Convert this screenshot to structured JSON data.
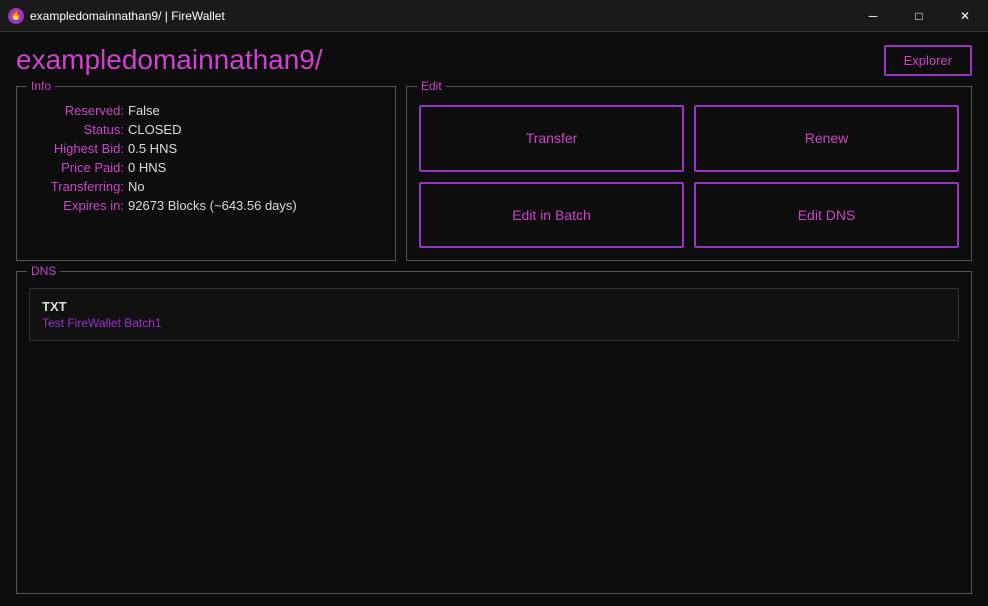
{
  "titlebar": {
    "app_name": "exampledomainnathan9/ | FireWallet",
    "icon": "🔥",
    "minimize": "─",
    "maximize": "□",
    "close": "✕"
  },
  "header": {
    "domain_title": "exampledomainnathan9/",
    "explorer_label": "Explorer"
  },
  "info_panel": {
    "legend": "Info",
    "fields": [
      {
        "label": "Reserved:",
        "value": "False"
      },
      {
        "label": "Status:",
        "value": "CLOSED"
      },
      {
        "label": "Highest Bid:",
        "value": "0.5 HNS"
      },
      {
        "label": "Price Paid:",
        "value": "0 HNS"
      },
      {
        "label": "Transferring:",
        "value": "No"
      },
      {
        "label": "Expires in:",
        "value": "92673 Blocks (~643.56 days)"
      }
    ]
  },
  "edit_panel": {
    "legend": "Edit",
    "buttons": [
      {
        "id": "transfer",
        "label": "Transfer"
      },
      {
        "id": "renew",
        "label": "Renew"
      },
      {
        "id": "edit-in-batch",
        "label": "Edit in Batch"
      },
      {
        "id": "edit-dns",
        "label": "Edit DNS"
      }
    ]
  },
  "dns_panel": {
    "legend": "DNS",
    "record": {
      "type": "TXT",
      "value": "Test FireWallet Batch1"
    }
  }
}
